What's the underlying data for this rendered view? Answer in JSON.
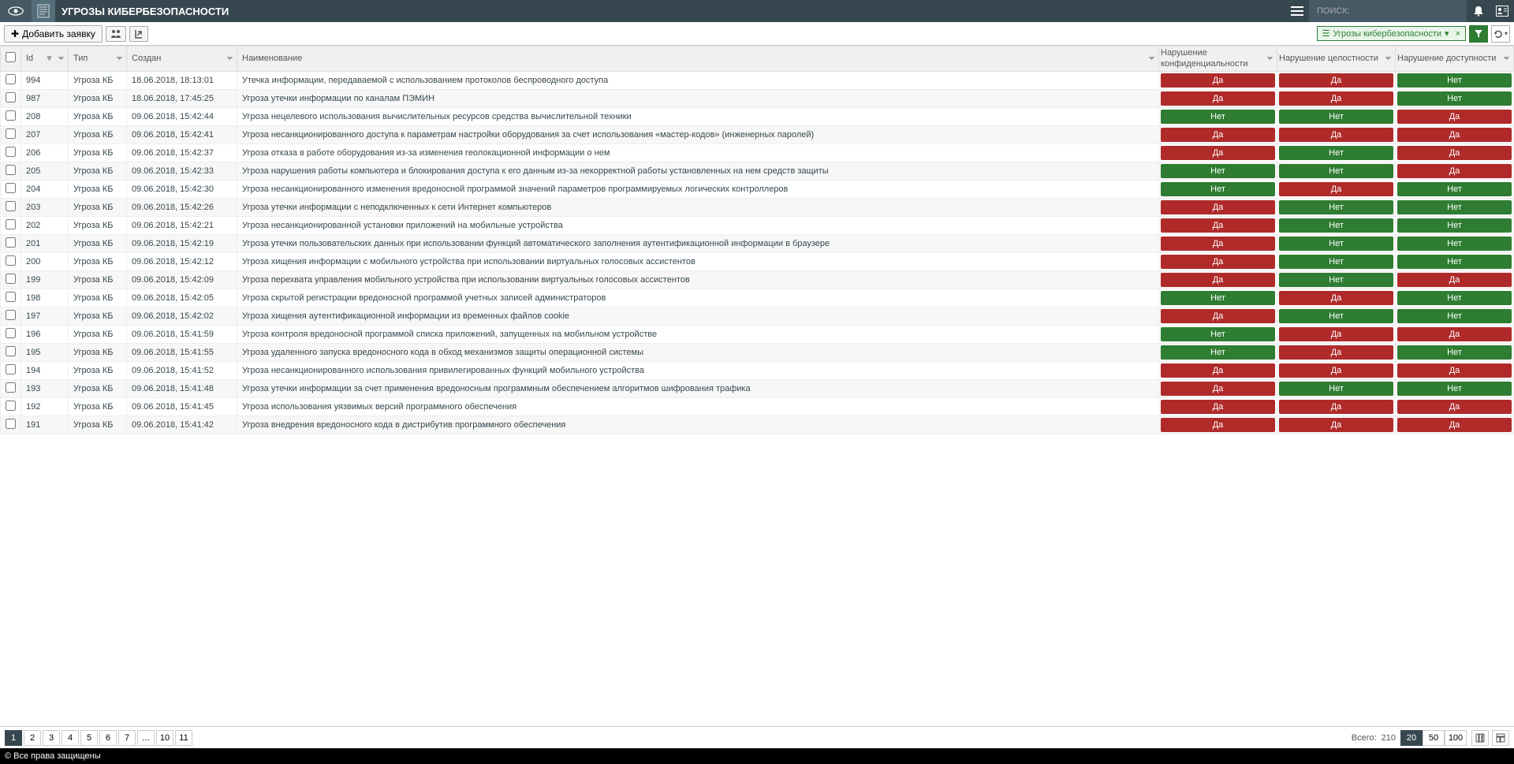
{
  "header": {
    "title": "УГРОЗЫ КИБЕРБЕЗОПАСНОСТИ",
    "search_placeholder": "ПОИСК:"
  },
  "toolbar": {
    "add_label": "Добавить заявку",
    "view_name": "Угрозы кибербезопасности"
  },
  "columns": {
    "id": "Id",
    "type": "Тип",
    "created": "Создан",
    "name": "Наименование",
    "conf": "Нарушение конфиденциальности",
    "integ": "Нарушение целостности",
    "avail": "Нарушение доступности"
  },
  "badges": {
    "yes": "Да",
    "no": "Нет"
  },
  "rows": [
    {
      "id": "994",
      "type": "Угроза КБ",
      "date": "18.06.2018, 18:13:01",
      "name": "Утечка информации, передаваемой с использованием протоколов беспроводного доступа",
      "c": true,
      "i": true,
      "a": false
    },
    {
      "id": "987",
      "type": "Угроза КБ",
      "date": "18.06.2018, 17:45:25",
      "name": "Угроза утечки информации по каналам ПЭМИН",
      "c": true,
      "i": true,
      "a": false
    },
    {
      "id": "208",
      "type": "Угроза КБ",
      "date": "09.06.2018, 15:42:44",
      "name": "Угроза нецелевого использования вычислительных ресурсов средства вычислительной техники",
      "c": false,
      "i": false,
      "a": true
    },
    {
      "id": "207",
      "type": "Угроза КБ",
      "date": "09.06.2018, 15:42:41",
      "name": "Угроза несанкционированного доступа к параметрам настройки оборудования за счет использования «мастер-кодов» (инженерных паролей)",
      "c": true,
      "i": true,
      "a": true
    },
    {
      "id": "206",
      "type": "Угроза КБ",
      "date": "09.06.2018, 15:42:37",
      "name": "Угроза отказа в работе оборудования из-за изменения геолокационной информации о нем",
      "c": true,
      "i": false,
      "a": true
    },
    {
      "id": "205",
      "type": "Угроза КБ",
      "date": "09.06.2018, 15:42:33",
      "name": "Угроза нарушения работы компьютера и блокирования доступа к его данным из-за некорректной работы установленных на нем средств защиты",
      "c": false,
      "i": false,
      "a": true
    },
    {
      "id": "204",
      "type": "Угроза КБ",
      "date": "09.06.2018, 15:42:30",
      "name": "Угроза несанкционированного изменения вредоносной программой значений параметров программируемых логических контроллеров",
      "c": false,
      "i": true,
      "a": false
    },
    {
      "id": "203",
      "type": "Угроза КБ",
      "date": "09.06.2018, 15:42:26",
      "name": "Угроза утечки информации с неподключенных к сети Интернет компьютеров",
      "c": true,
      "i": false,
      "a": false
    },
    {
      "id": "202",
      "type": "Угроза КБ",
      "date": "09.06.2018, 15:42:21",
      "name": "Угроза несанкционированной установки приложений на мобильные устройства",
      "c": true,
      "i": false,
      "a": false
    },
    {
      "id": "201",
      "type": "Угроза КБ",
      "date": "09.06.2018, 15:42:19",
      "name": "Угроза утечки пользовательских данных при использовании функций автоматического заполнения аутентификационной информации в браузере",
      "c": true,
      "i": false,
      "a": false
    },
    {
      "id": "200",
      "type": "Угроза КБ",
      "date": "09.06.2018, 15:42:12",
      "name": "Угроза хищения информации с мобильного устройства при использовании виртуальных голосовых ассистентов",
      "c": true,
      "i": false,
      "a": false
    },
    {
      "id": "199",
      "type": "Угроза КБ",
      "date": "09.06.2018, 15:42:09",
      "name": "Угроза перехвата управления мобильного устройства при использовании виртуальных голосовых ассистентов",
      "c": true,
      "i": false,
      "a": true
    },
    {
      "id": "198",
      "type": "Угроза КБ",
      "date": "09.06.2018, 15:42:05",
      "name": "Угроза скрытой регистрации вредоносной программой учетных записей администраторов",
      "c": false,
      "i": true,
      "a": false
    },
    {
      "id": "197",
      "type": "Угроза КБ",
      "date": "09.06.2018, 15:42:02",
      "name": "Угроза хищения аутентификационной информации из временных файлов cookie",
      "c": true,
      "i": false,
      "a": false
    },
    {
      "id": "196",
      "type": "Угроза КБ",
      "date": "09.06.2018, 15:41:59",
      "name": "Угроза контроля вредоносной программой списка приложений, запущенных на мобильном устройстве",
      "c": false,
      "i": true,
      "a": true
    },
    {
      "id": "195",
      "type": "Угроза КБ",
      "date": "09.06.2018, 15:41:55",
      "name": "Угроза удаленного запуска вредоносного кода в обход механизмов защиты операционной системы",
      "c": false,
      "i": true,
      "a": false
    },
    {
      "id": "194",
      "type": "Угроза КБ",
      "date": "09.06.2018, 15:41:52",
      "name": "Угроза несанкционированного использования привилегированных функций мобильного устройства",
      "c": true,
      "i": true,
      "a": true
    },
    {
      "id": "193",
      "type": "Угроза КБ",
      "date": "09.06.2018, 15:41:48",
      "name": "Угроза утечки информации за счет применения вредоносным программным обеспечением алгоритмов шифрования трафика",
      "c": true,
      "i": false,
      "a": false
    },
    {
      "id": "192",
      "type": "Угроза КБ",
      "date": "09.06.2018, 15:41:45",
      "name": "Угроза использования уязвимых версий программного обеспечения",
      "c": true,
      "i": true,
      "a": true
    },
    {
      "id": "191",
      "type": "Угроза КБ",
      "date": "09.06.2018, 15:41:42",
      "name": "Угроза внедрения вредоносного кода в дистрибутив программного обеспечения",
      "c": true,
      "i": true,
      "a": true
    }
  ],
  "pagination": {
    "pages": [
      "1",
      "2",
      "3",
      "4",
      "5",
      "6",
      "7",
      "...",
      "10",
      "11"
    ],
    "active": "1"
  },
  "footer": {
    "total_label": "Всего:",
    "total_value": "210",
    "page_sizes": [
      "20",
      "50",
      "100"
    ],
    "active_size": "20"
  },
  "copyright": "© Все права защищены"
}
